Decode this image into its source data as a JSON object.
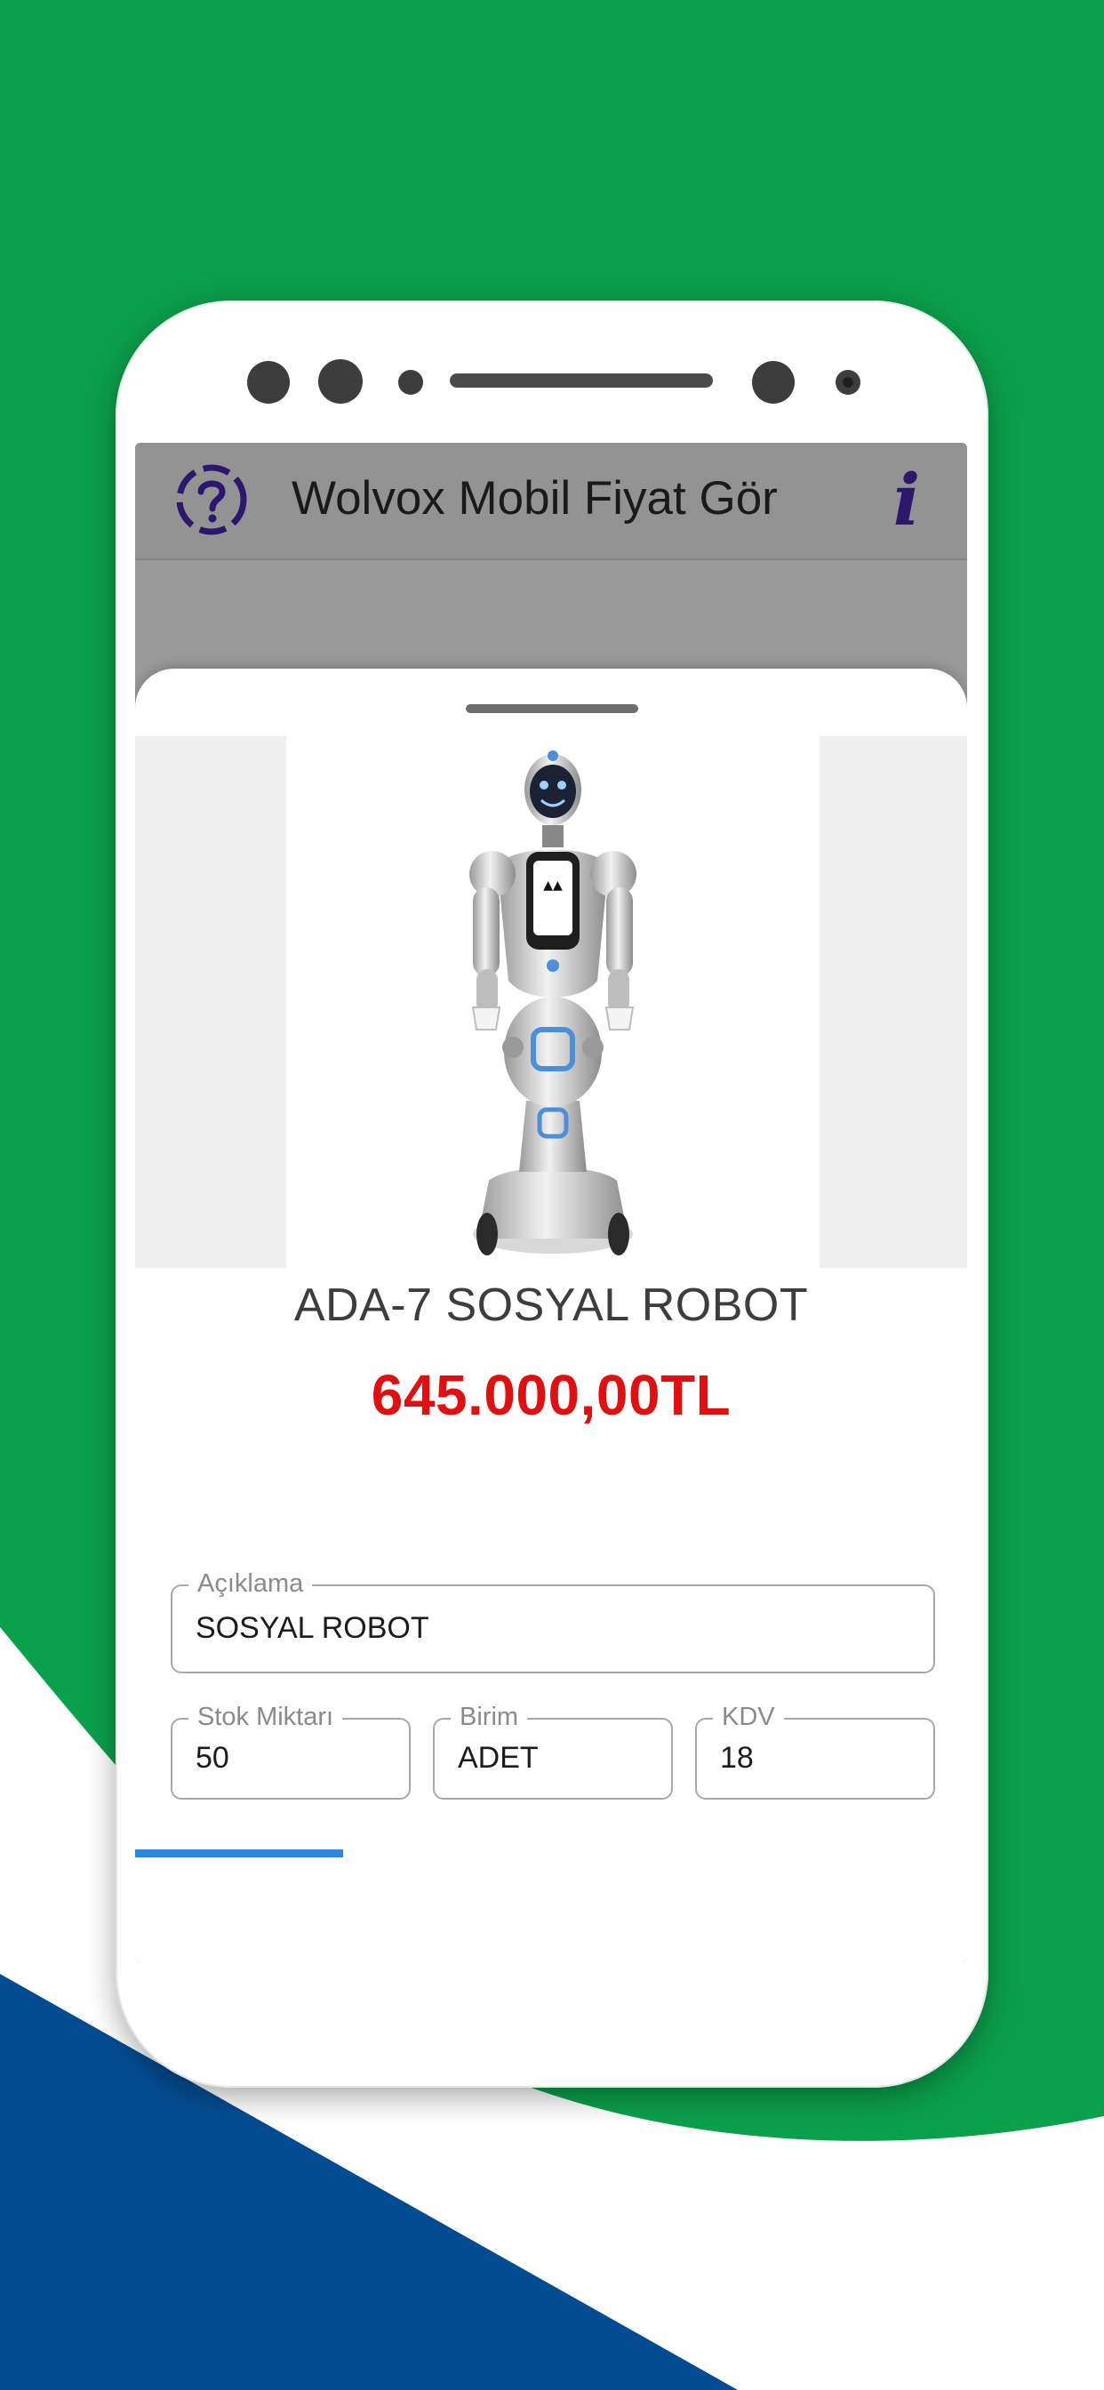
{
  "app": {
    "title": "Wolvox Mobil Fiyat Gör"
  },
  "colors": {
    "background_green": "#0ba04c",
    "background_blue": "#034c92",
    "app_bar": "#939393",
    "price": "#e01010",
    "progress": "#2e86de",
    "icon_purple": "#2c166e"
  },
  "icons": {
    "help": "question-circle-icon",
    "info": "info-icon"
  },
  "product": {
    "name": "ADA-7 SOSYAL ROBOT",
    "price": "645.000,00TL",
    "image": "robot-image"
  },
  "fields": {
    "description": {
      "label": "Açıklama",
      "value": "SOSYAL ROBOT"
    },
    "stock": {
      "label": "Stok Miktarı",
      "value": "50"
    },
    "unit": {
      "label": "Birim",
      "value": "ADET"
    },
    "vat": {
      "label": "KDV",
      "value": "18"
    }
  },
  "progress": {
    "fraction": 0.25
  }
}
